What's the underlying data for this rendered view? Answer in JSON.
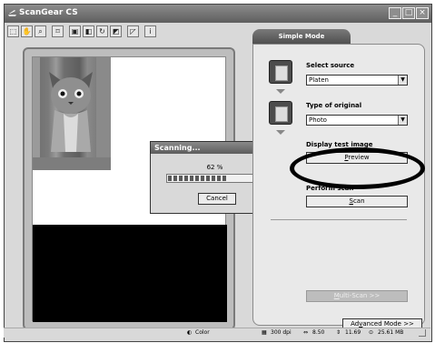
{
  "window": {
    "title": "ScanGear CS"
  },
  "toolbar": {
    "tools": [
      "crop-tool-icon",
      "hand-tool-icon",
      "zoom-tool-icon",
      "fit-tool-icon",
      "auto-crop-icon",
      "mirror-icon",
      "rotate-icon",
      "invert-icon",
      "thumbnail-view-icon",
      "info-icon"
    ]
  },
  "mode_tab": {
    "label": "Simple Mode"
  },
  "steps": {
    "select_source": {
      "label": "Select source",
      "value": "Platen"
    },
    "type_of_original": {
      "label": "Type of original",
      "value": "Photo"
    },
    "display_test_image": {
      "label": "Display test image",
      "button_prefix": "P",
      "button_rest": "review"
    },
    "perform_scan": {
      "label": "Perform scan",
      "button_prefix": "S",
      "button_rest": "can"
    }
  },
  "multi_scan": {
    "prefix": "M",
    "rest": "ulti-Scan >>"
  },
  "advanced_mode": {
    "pre": "Ad",
    "mn": "v",
    "post": "anced Mode >>"
  },
  "scanning_dialog": {
    "title": "Scanning...",
    "percent_text": "62 %",
    "progress": 0.62,
    "cancel_label": "Cancel"
  },
  "status_bar": {
    "color_mode": "Color",
    "resolution": "300 dpi",
    "width": "8.50",
    "height": "11.69",
    "file_size": "25.61 MB"
  }
}
